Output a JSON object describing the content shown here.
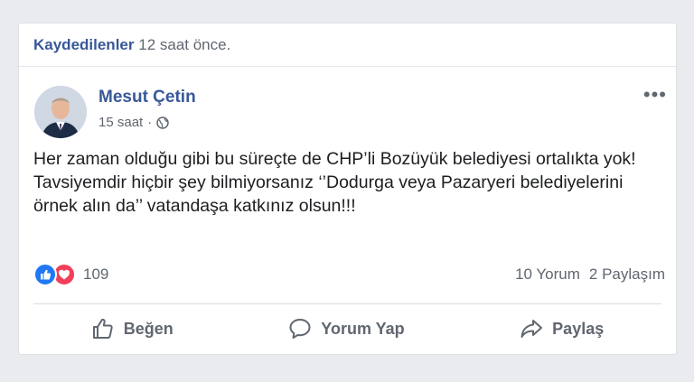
{
  "saved_bar": {
    "label": "Kaydedilenler",
    "time": "12 saat önce."
  },
  "post": {
    "author": "Mesut Çetin",
    "time": "15 saat",
    "separator": "·",
    "privacy_icon": "globe-icon",
    "more_icon": "•••",
    "text_lines": [
      "Her zaman olduğu gibi bu süreçte de CHP’li Bozüyük belediyesi ortalıkta yok!",
      "Tavsiyemdir hiçbir şey bilmiyorsanız ‘’Dodurga veya Pazaryeri belediyelerini örnek alın da’’ vatandaşa katkınız olsun!!!"
    ]
  },
  "reactions": {
    "icons": [
      "like-icon",
      "love-icon"
    ],
    "count": "109",
    "comments": "10 Yorum",
    "shares": "2 Paylaşım"
  },
  "actions": {
    "like_label": "Beğen",
    "comment_label": "Yorum Yap",
    "share_label": "Paylaş"
  },
  "colors": {
    "link_blue": "#385898",
    "like_blue": "#2078f4",
    "love_red": "#f33e58",
    "secondary_text": "#606770"
  }
}
